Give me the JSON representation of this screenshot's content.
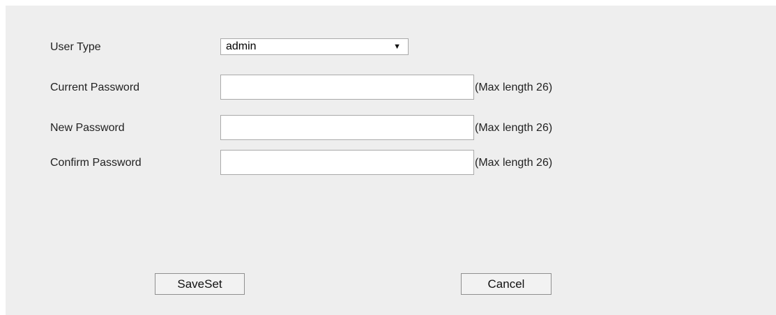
{
  "form": {
    "user_type": {
      "label": "User Type",
      "selected_value": "admin"
    },
    "current_password": {
      "label": "Current Password",
      "value": "",
      "hint": "(Max length 26)"
    },
    "new_password": {
      "label": "New Password",
      "value": "",
      "hint": "(Max length 26)"
    },
    "confirm_password": {
      "label": "Confirm Password",
      "value": "",
      "hint": "(Max length 26)"
    }
  },
  "actions": {
    "save_label": "SaveSet",
    "cancel_label": "Cancel"
  },
  "icons": {
    "dropdown": "chevron-down-icon"
  },
  "colors": {
    "panel_background": "#eeeeee",
    "page_background": "#ffffff"
  }
}
